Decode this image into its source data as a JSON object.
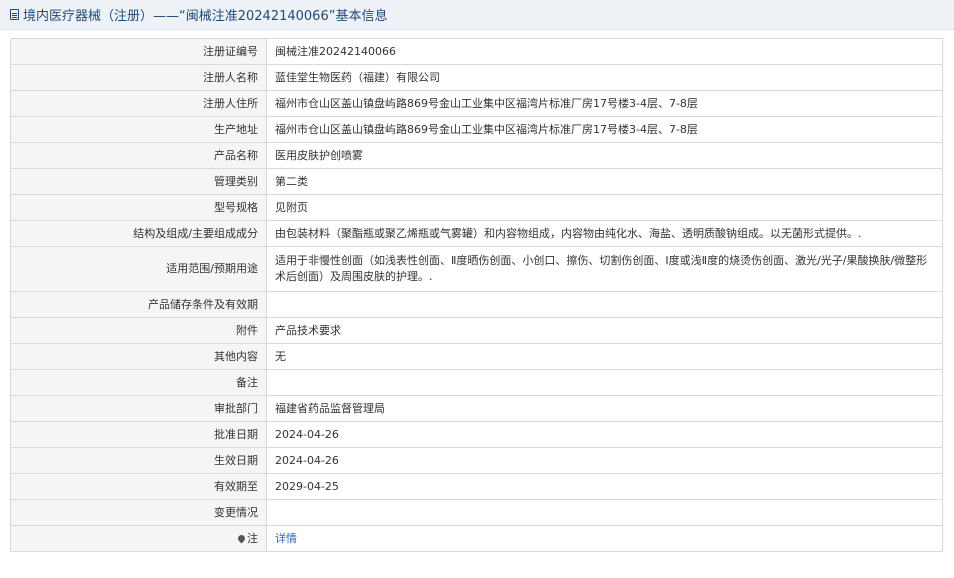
{
  "header": {
    "title": "境内医疗器械（注册）——“闽械注准20242140066”基本信息"
  },
  "rows": [
    {
      "label": "注册证编号",
      "value": "闽械注准20242140066"
    },
    {
      "label": "注册人名称",
      "value": "蓝佳堂生物医药（福建）有限公司"
    },
    {
      "label": "注册人住所",
      "value": "福州市仓山区盖山镇盘屿路869号金山工业集中区福湾片标准厂房17号楼3-4层、7-8层"
    },
    {
      "label": "生产地址",
      "value": "福州市仓山区盖山镇盘屿路869号金山工业集中区福湾片标准厂房17号楼3-4层、7-8层"
    },
    {
      "label": "产品名称",
      "value": "医用皮肤护创喷雾"
    },
    {
      "label": "管理类别",
      "value": "第二类"
    },
    {
      "label": "型号规格",
      "value": "见附页"
    },
    {
      "label": "结构及组成/主要组成成分",
      "value": "由包装材料（聚酯瓶或聚乙烯瓶或气雾罐）和内容物组成，内容物由纯化水、海盐、透明质酸钠组成。以无菌形式提供。."
    },
    {
      "label": "适用范围/预期用途",
      "value": "适用于非慢性创面（如浅表性创面、Ⅱ度晒伤创面、小创口、擦伤、切割伤创面、Ⅰ度或浅Ⅱ度的烧烫伤创面、激光/光子/果酸换肤/微整形术后创面）及周围皮肤的护理。."
    },
    {
      "label": "产品储存条件及有效期",
      "value": ""
    },
    {
      "label": "附件",
      "value": "产品技术要求"
    },
    {
      "label": "其他内容",
      "value": "无"
    },
    {
      "label": "备注",
      "value": ""
    },
    {
      "label": "审批部门",
      "value": "福建省药品监督管理局"
    },
    {
      "label": "批准日期",
      "value": "2024-04-26"
    },
    {
      "label": "生效日期",
      "value": "2024-04-26"
    },
    {
      "label": "有效期至",
      "value": "2029-04-25"
    },
    {
      "label": "变更情况",
      "value": ""
    }
  ],
  "note": {
    "label": "注",
    "link": "详情",
    "icon": "pin-icon"
  }
}
